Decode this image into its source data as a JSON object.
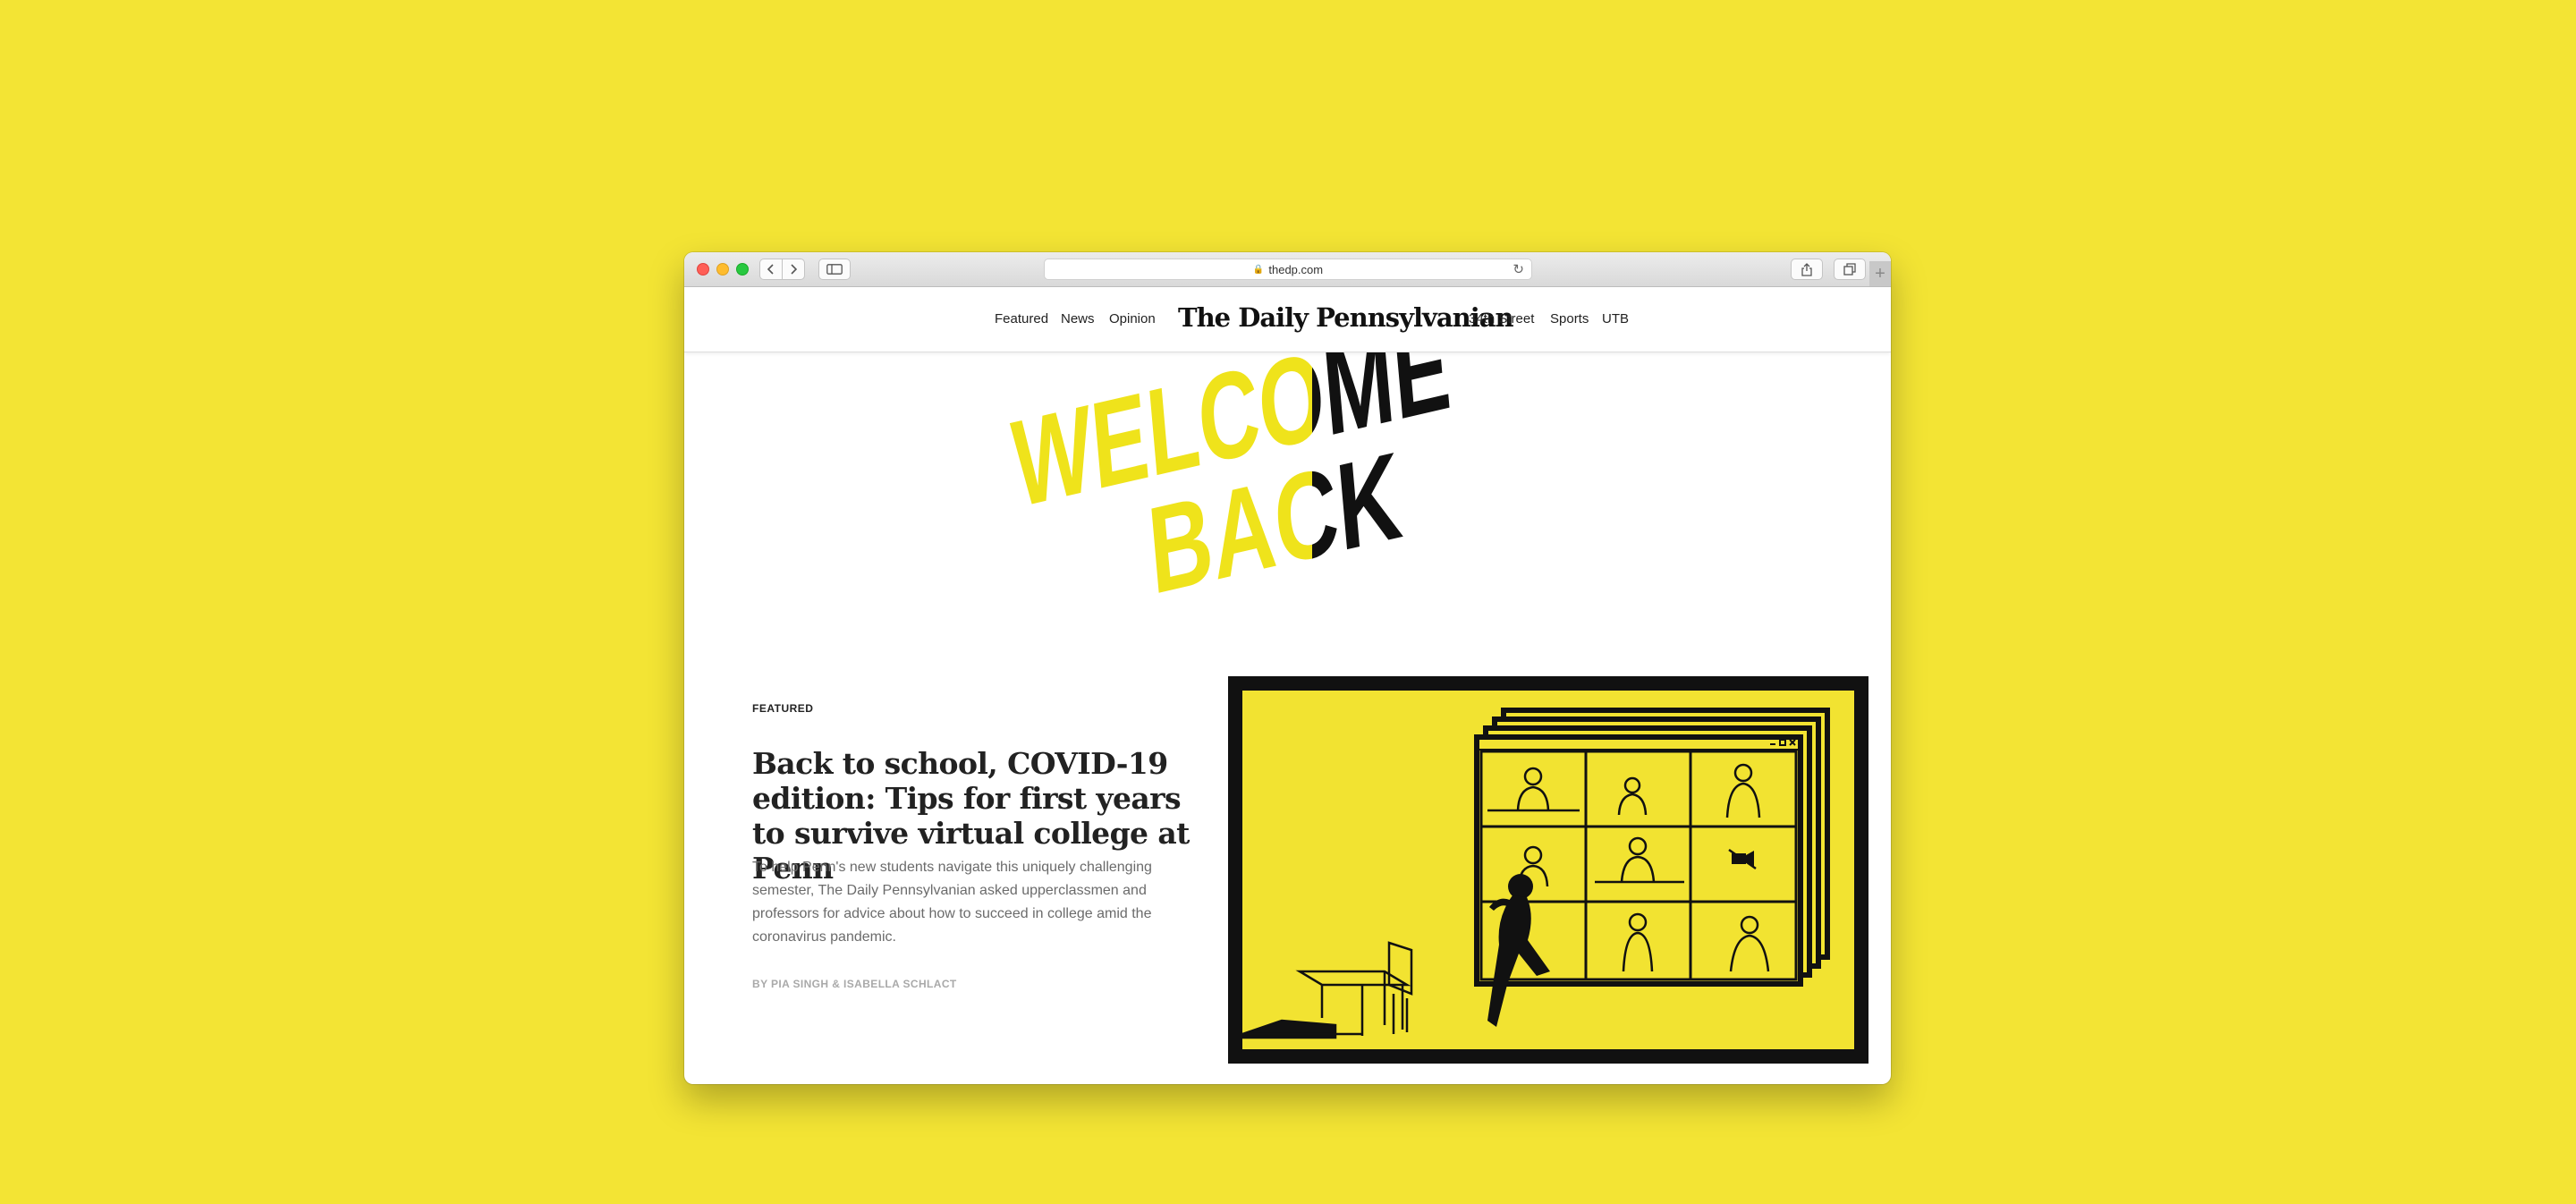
{
  "browser": {
    "url": "thedp.com",
    "nav_back_icon": "chevron-left-icon",
    "nav_forward_icon": "chevron-right-icon",
    "new_tab_label": "+"
  },
  "site": {
    "logo": "The Daily Pennsylvanian",
    "nav_left": [
      "Featured",
      "News",
      "Opinion"
    ],
    "nav_right": [
      "34th Street",
      "Sports",
      "UTB"
    ]
  },
  "hero": {
    "line1": "WELCOME",
    "line2": "BACK",
    "colors": {
      "yellow": "#efe31b",
      "black": "#111111"
    }
  },
  "article": {
    "kicker": "FEATURED",
    "headline": "Back to school, COVID-19 edition: Tips for first years to survive virtual college at Penn",
    "dek": "To help Penn's new students navigate this uniquely challenging semester, The Daily Pennsylvanian asked upperclassmen and professors for advice about how to succeed in college amid the coronavirus pandemic.",
    "byline": "BY PIA SINGH & ISABELLA SCHLACT"
  },
  "colors": {
    "page_background": "#f3e434",
    "illustration_background": "#f2e331",
    "ink": "#111111"
  }
}
